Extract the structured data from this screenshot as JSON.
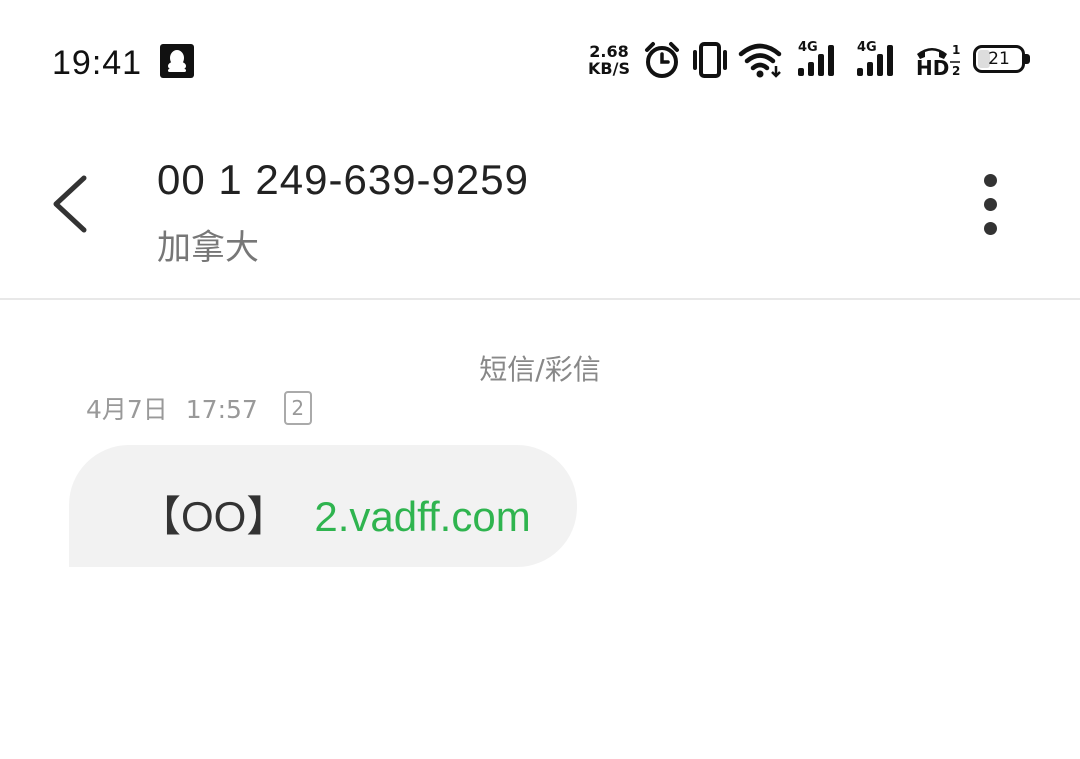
{
  "status_bar": {
    "time": "19:41",
    "net_speed_value": "2.68",
    "net_speed_unit": "KB/S",
    "signal1_label": "4G",
    "signal2_label": "4G",
    "hd_label": "HD",
    "battery_level": "21",
    "icons": [
      "qq-icon",
      "alarm-icon",
      "vibrate-icon",
      "wifi-icon",
      "signal-icon",
      "signal-icon",
      "hd-call-icon",
      "battery-icon"
    ]
  },
  "header": {
    "contact_number": "00 1 249-639-9259",
    "contact_location": "加拿大"
  },
  "conversation": {
    "channel_label": "短信/彩信",
    "messages": [
      {
        "date": "4月7日",
        "time": "17:57",
        "sim_slot": "2",
        "bracket_text": "【OO】",
        "link_text": "2.vadff.com"
      }
    ]
  },
  "colors": {
    "link": "#2fb44f",
    "bubble_bg": "#f2f2f2"
  }
}
